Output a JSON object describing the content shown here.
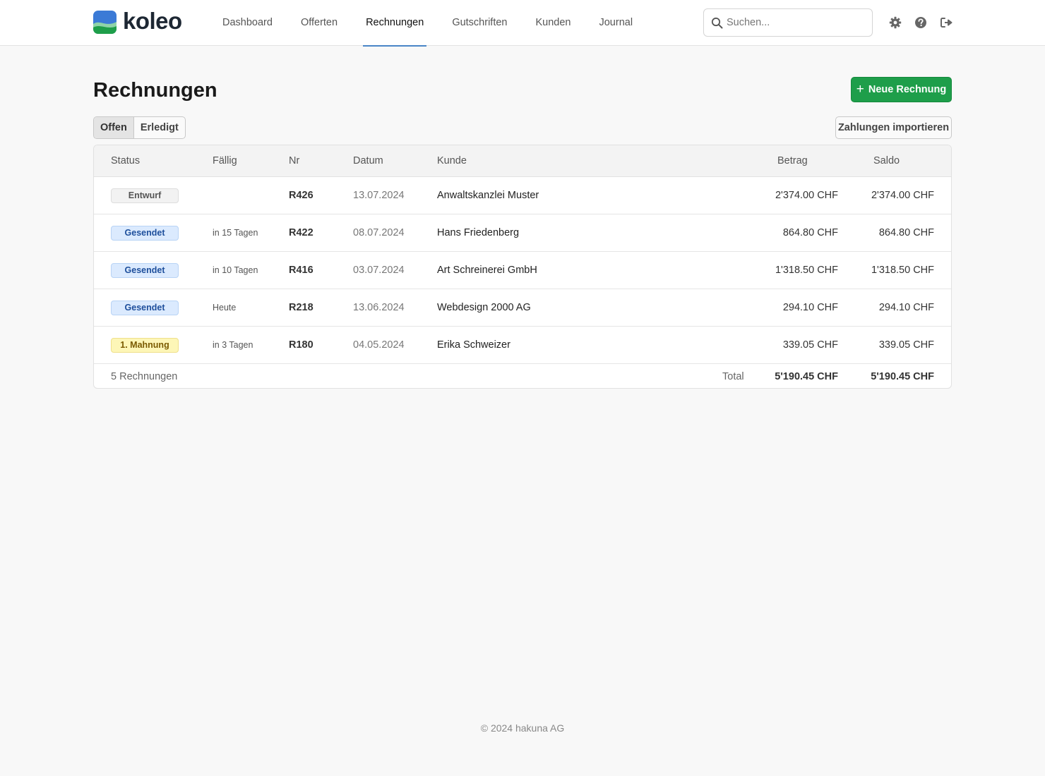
{
  "app": {
    "name": "koleo",
    "colors": {
      "primary": "#1e9e4a",
      "accent": "#4a86c7",
      "logo_top": "#3b7ad6",
      "logo_bottom": "#1e9e4a"
    }
  },
  "nav": {
    "items": [
      {
        "label": "Dashboard",
        "active": false
      },
      {
        "label": "Offerten",
        "active": false
      },
      {
        "label": "Rechnungen",
        "active": true
      },
      {
        "label": "Gutschriften",
        "active": false
      },
      {
        "label": "Kunden",
        "active": false
      },
      {
        "label": "Journal",
        "active": false
      }
    ]
  },
  "search": {
    "placeholder": "Suchen...",
    "value": ""
  },
  "header_icons": [
    "gear-icon",
    "help-icon",
    "logout-icon"
  ],
  "page": {
    "title": "Rechnungen",
    "new_button_label": "Neue Rechnung",
    "filters": [
      {
        "label": "Offen",
        "active": true
      },
      {
        "label": "Erledigt",
        "active": false
      }
    ],
    "import_button_label": "Zahlungen importieren"
  },
  "table": {
    "columns": {
      "status": "Status",
      "due": "Fällig",
      "nr": "Nr",
      "date": "Datum",
      "customer": "Kunde",
      "amount": "Betrag",
      "balance": "Saldo"
    },
    "rows": [
      {
        "status": "Entwurf",
        "status_kind": "draft",
        "due": "",
        "nr": "R426",
        "date": "13.07.2024",
        "customer": "Anwaltskanzlei Muster",
        "amount": "2'374.00 CHF",
        "balance": "2'374.00 CHF"
      },
      {
        "status": "Gesendet",
        "status_kind": "sent",
        "due": "in 15 Tagen",
        "nr": "R422",
        "date": "08.07.2024",
        "customer": "Hans Friedenberg",
        "amount": "864.80 CHF",
        "balance": "864.80 CHF"
      },
      {
        "status": "Gesendet",
        "status_kind": "sent",
        "due": "in 10 Tagen",
        "nr": "R416",
        "date": "03.07.2024",
        "customer": "Art Schreinerei GmbH",
        "amount": "1'318.50 CHF",
        "balance": "1'318.50 CHF"
      },
      {
        "status": "Gesendet",
        "status_kind": "sent",
        "due": "Heute",
        "nr": "R218",
        "date": "13.06.2024",
        "customer": "Webdesign 2000 AG",
        "amount": "294.10 CHF",
        "balance": "294.10 CHF"
      },
      {
        "status": "1. Mahnung",
        "status_kind": "reminder",
        "due": "in 3 Tagen",
        "nr": "R180",
        "date": "04.05.2024",
        "customer": "Erika Schweizer",
        "amount": "339.05 CHF",
        "balance": "339.05 CHF"
      }
    ],
    "footer": {
      "count": "5 Rechnungen",
      "total_label": "Total",
      "total_amount": "5'190.45 CHF",
      "total_balance": "5'190.45 CHF"
    },
    "badge_styles": {
      "draft": {
        "bg": "#f2f2f2",
        "border": "#dddddd",
        "color": "#555555"
      },
      "sent": {
        "bg": "#dbeafe",
        "border": "#b8d3f5",
        "color": "#1e4f9c"
      },
      "reminder": {
        "bg": "#fdf6b7",
        "border": "#efe08a",
        "color": "#7a5a00"
      }
    }
  },
  "footer": {
    "text": "© 2024 hakuna AG"
  }
}
